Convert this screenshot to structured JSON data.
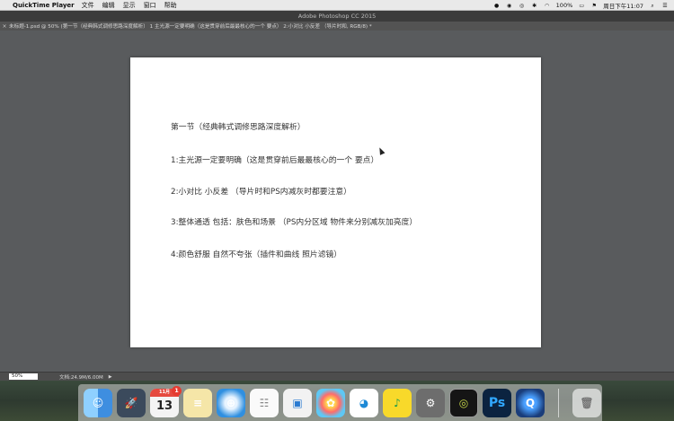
{
  "menubar": {
    "app_name": "QuickTime Player",
    "items": [
      "文件",
      "编辑",
      "显示",
      "窗口",
      "帮助"
    ],
    "battery": "100%",
    "clock": "周日下午11:07"
  },
  "photoshop": {
    "app_title": "Adobe Photoshop CC 2015",
    "tab_label": "未标题-1.psd @ 50% (第一节（经典韩式调修思路深度解析） 1 主光源一定要明确（这是贯穿前后最最核心的一个 要点） 2:小对比 小反差 （导片时和, RGB/8) *"
  },
  "canvas": {
    "lines": [
      "第一节（经典韩式调修思路深度解析）",
      "1:主光源一定要明确（这是贯穿前后最最核心的一个 要点）",
      "2:小对比 小反差 （导片时和PS内减灰时都要注意）",
      "3:整体通透 包括：肤色和场景 （PS内分区域 物件来分别减灰加亮度）",
      "4:颜色舒服 自然不夸张（插件和曲线 照片滤镜）"
    ]
  },
  "status": {
    "zoom": "50%",
    "doc_size": "文档:24.9M/6.00M"
  },
  "dock": {
    "calendar_month": "11月",
    "calendar_day": "13",
    "calendar_badge": "1",
    "ps_label": "Ps",
    "colors": {
      "finder": "#4fa4f0",
      "launchpad": "#3b4a5c",
      "safari": "#2f8fe0",
      "photoshop": "#0b2340",
      "quicktime": "#1a3d7a"
    }
  }
}
